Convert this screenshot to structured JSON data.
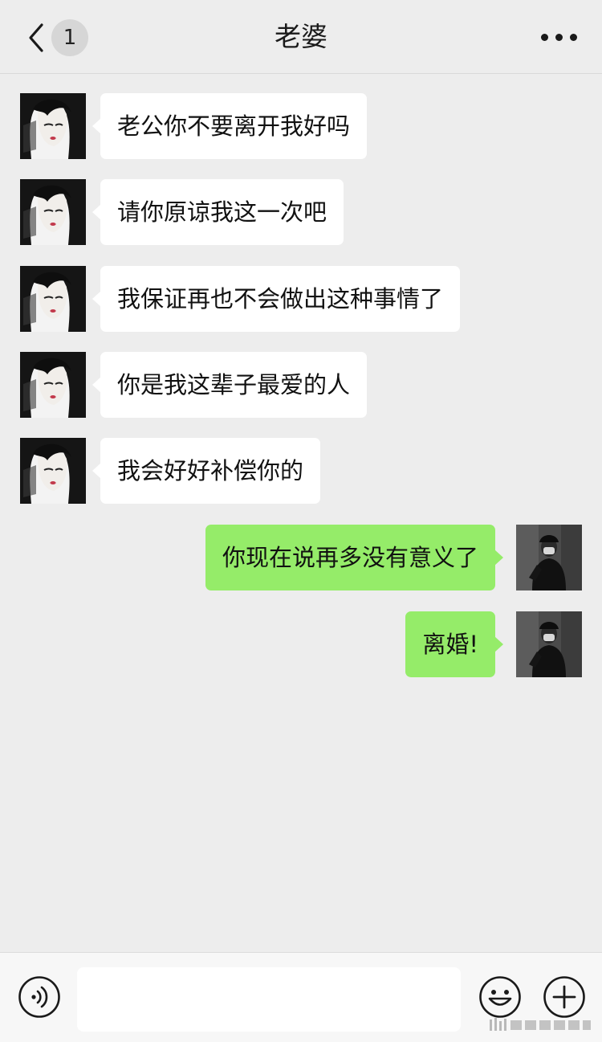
{
  "header": {
    "back_icon": "chevron-left-icon",
    "unread_count": "1",
    "title": "老婆",
    "more_icon": "more-dots-icon"
  },
  "messages": [
    {
      "side": "left",
      "sender": "contact",
      "text": "老公你不要离开我好吗"
    },
    {
      "side": "left",
      "sender": "contact",
      "text": "请你原谅我这一次吧"
    },
    {
      "side": "left",
      "sender": "contact",
      "text": "我保证再也不会做出这种事情了"
    },
    {
      "side": "left",
      "sender": "contact",
      "text": "你是我这辈子最爱的人"
    },
    {
      "side": "left",
      "sender": "contact",
      "text": "我会好好补偿你的"
    },
    {
      "side": "right",
      "sender": "me",
      "text": "你现在说再多没有意义了"
    },
    {
      "side": "right",
      "sender": "me",
      "text": "离婚!"
    }
  ],
  "input_bar": {
    "voice_icon": "voice-icon",
    "input_value": "",
    "emoji_icon": "emoji-icon",
    "plus_icon": "plus-circle-icon"
  },
  "colors": {
    "background": "#ededed",
    "incoming_bubble": "#ffffff",
    "outgoing_bubble": "#95ec69",
    "input_bar": "#f7f7f7"
  }
}
